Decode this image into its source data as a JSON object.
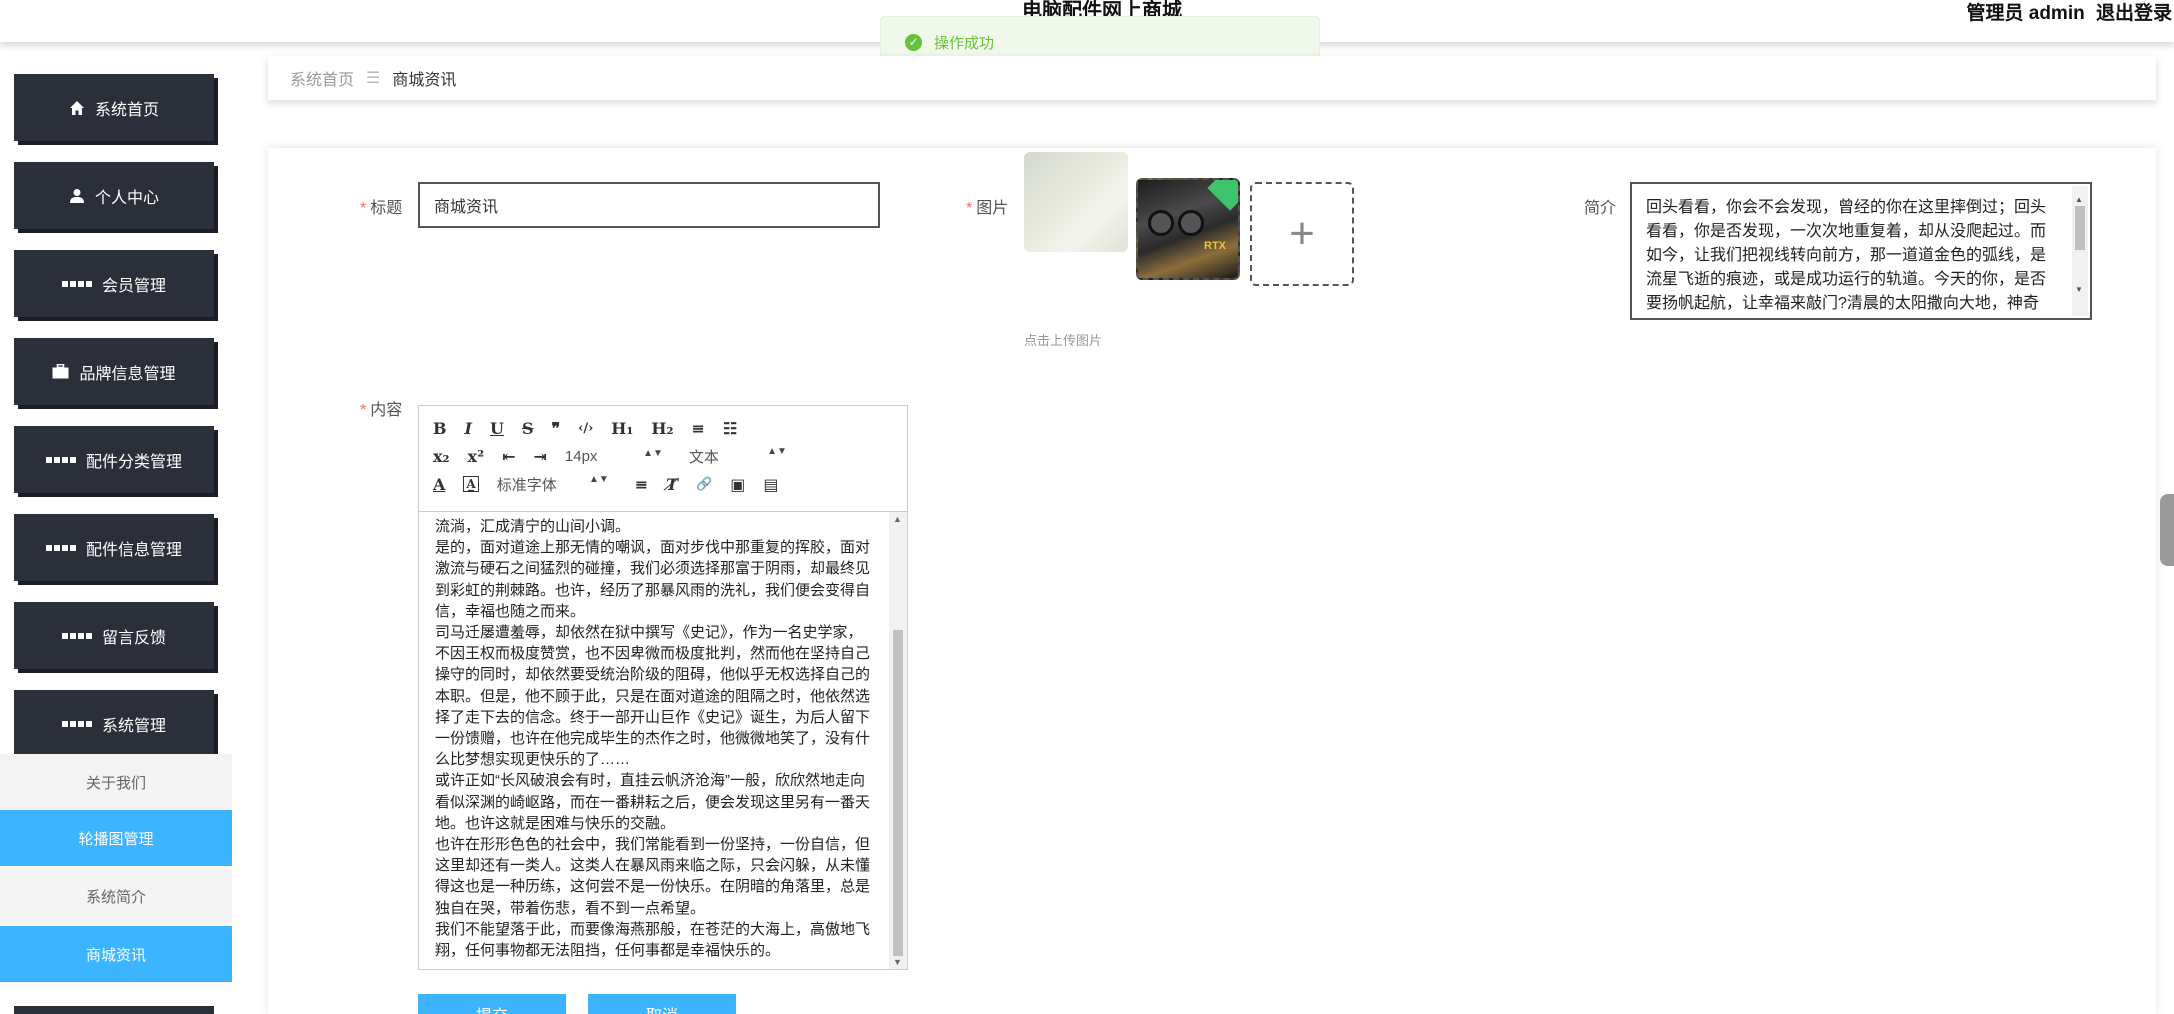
{
  "header": {
    "site_title": "电脑配件网上商城",
    "admin_label": "管理员 admin",
    "logout_label": "退出登录"
  },
  "toast": {
    "message": "操作成功",
    "icon": "check-icon"
  },
  "sidebar": {
    "items": [
      {
        "label": "系统首页",
        "icon": "home-icon"
      },
      {
        "label": "个人中心",
        "icon": "user-icon"
      },
      {
        "label": "会员管理",
        "icon": "grid-icon"
      },
      {
        "label": "品牌信息管理",
        "icon": "briefcase-icon"
      },
      {
        "label": "配件分类管理",
        "icon": "grid-icon"
      },
      {
        "label": "配件信息管理",
        "icon": "grid-icon"
      },
      {
        "label": "留言反馈",
        "icon": "grid-icon"
      },
      {
        "label": "系统管理",
        "icon": "grid-icon"
      }
    ],
    "sub_items": [
      {
        "label": "关于我们",
        "active": false
      },
      {
        "label": "轮播图管理",
        "active": true
      },
      {
        "label": "系统简介",
        "active": false
      },
      {
        "label": "商城资讯",
        "active": true
      }
    ]
  },
  "breadcrumb": {
    "home": "系统首页",
    "separator": "☰",
    "current": "商城资讯"
  },
  "form": {
    "title_label": "标题",
    "title_value": "商城资讯",
    "image_label": "图片",
    "upload_tip": "点击上传图片",
    "upload_plus": "+",
    "image_badge": "RTX",
    "intro_label": "简介",
    "intro_value": "回头看看，你会不会发现，曾经的你在这里摔倒过；回头看看，你是否发现，一次次地重复着，却从没爬起过。而如今，让我们把视线转向前方，那一道道金色的弧线，是流星飞逝的痕迹，或是成功运行的轨道。今天的你，是否要扬帆起航，让幸福来敲门?清晨的太阳撒向大地，神奇",
    "content_label": "内容",
    "required_mark": "*",
    "submit_label": "提交",
    "cancel_label": "取消"
  },
  "editor": {
    "row1": [
      "B",
      "I",
      "U",
      "S",
      "❞",
      "‹/›",
      "H₁",
      "H₂",
      "≡",
      "☷"
    ],
    "row2": [
      "x₂",
      "x²",
      "⇤",
      "⇥"
    ],
    "font_size": "14px",
    "block_type": "文本",
    "font_family": "标准字体",
    "row3_icons": [
      "A",
      "A̲",
      "≡",
      "T̸",
      "🔗",
      "▣",
      "▤"
    ],
    "content_paragraphs": [
      "流淌，汇成清宁的山间小调。",
      "是的，面对道途上那无情的嘲讽，面对步伐中那重复的挥胶，面对激流与硬石之间猛烈的碰撞，我们必须选择那富于阴雨，却最终见到彩虹的荆棘路。也许，经历了那暴风雨的洗礼，我们便会变得自信，幸福也随之而来。",
      "司马迁屡遭羞辱，却依然在狱中撰写《史记》，作为一名史学家，不因王权而极度赞赏，也不因卑微而极度批判，然而他在坚持自己操守的同时，却依然要受统治阶级的阻碍，他似乎无权选择自己的本职。但是，他不顾于此，只是在面对道途的阻隔之时，他依然选择了走下去的信念。终于一部开山巨作《史记》诞生，为后人留下一份馈赠，也许在他完成毕生的杰作之时，他微微地笑了，没有什么比梦想实现更快乐的了……",
      "或许正如“长风破浪会有时，直挂云帆济沧海”一般，欣欣然地走向看似深渊的崎岖路，而在一番耕耘之后，便会发现这里另有一番天地。也许这就是困难与快乐的交融。",
      "也许在形形色色的社会中，我们常能看到一份坚持，一份自信，但这里却还有一类人。这类人在暴风雨来临之际，只会闪躲，从未懂得这也是一种历练，这何尝不是一份快乐。在阴暗的角落里，总是独自在哭，带着伤悲，看不到一点希望。",
      "我们不能望落于此，而要像海燕那般，在苍茫的大海上，高傲地飞翔，任何事物都无法阻挡，任何事都是幸福快乐的。"
    ]
  }
}
